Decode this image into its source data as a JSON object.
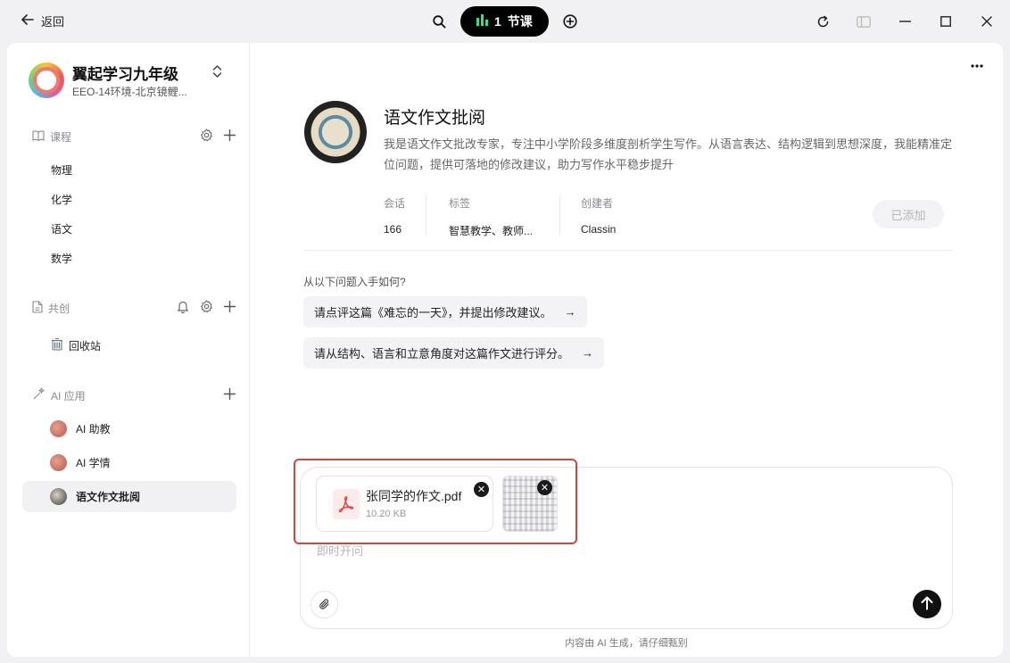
{
  "titlebar": {
    "back_label": "返回",
    "lesson_count": "1",
    "lesson_unit": "节课"
  },
  "sidebar": {
    "school_name": "翼起学习九年级",
    "school_sub": "EEO-14环境-北京镜鲤...",
    "courses_label": "课程",
    "courses": [
      "物理",
      "化学",
      "语文",
      "数学"
    ],
    "cocreate_label": "共创",
    "recycle_label": "回收站",
    "ai_label": "AI 应用",
    "ai_items": [
      "AI 助教",
      "AI 学情",
      "语文作文批阅"
    ]
  },
  "agent": {
    "title": "语文作文批阅",
    "description": "我是语文作文批改专家，专注中小学阶段多维度剖析学生写作。从语言表达、结构逻辑到思想深度，我能精准定位问题，提供可落地的修改建议，助力写作水平稳步提升",
    "sessions_label": "会话",
    "sessions_value": "166",
    "tags_label": "标签",
    "tags_value": "智慧教学、教师...",
    "creator_label": "创建者",
    "creator_value": "Classin",
    "added_label": "已添加"
  },
  "suggestions": {
    "heading": "从以下问题入手如何?",
    "items": [
      "请点评这篇《难忘的一天》，并提出修改建议。",
      "请从结构、语言和立意角度对这篇作文进行评分。"
    ]
  },
  "composer": {
    "file_name": "张同学的作文.pdf",
    "file_size": "10.20 KB",
    "placeholder": "即时开问"
  },
  "disclaimer": "内容由 AI 生成，请仔细甄别",
  "colors": {
    "highlight": "#d0453c",
    "bars": "#3ddc84",
    "pdf": "#e2413b"
  },
  "icons": [
    "arrow-left-icon",
    "search-icon",
    "bar-chart-icon",
    "plus-circle-icon",
    "refresh-icon",
    "sidebar-icon",
    "minimize-icon",
    "maximize-icon",
    "close-icon",
    "more-icon",
    "book-icon",
    "gear-icon",
    "plus-icon",
    "doc-icon",
    "bell-icon",
    "trash-icon",
    "sparkle-icon",
    "pdf-icon",
    "paperclip-icon",
    "arrow-up-icon"
  ]
}
